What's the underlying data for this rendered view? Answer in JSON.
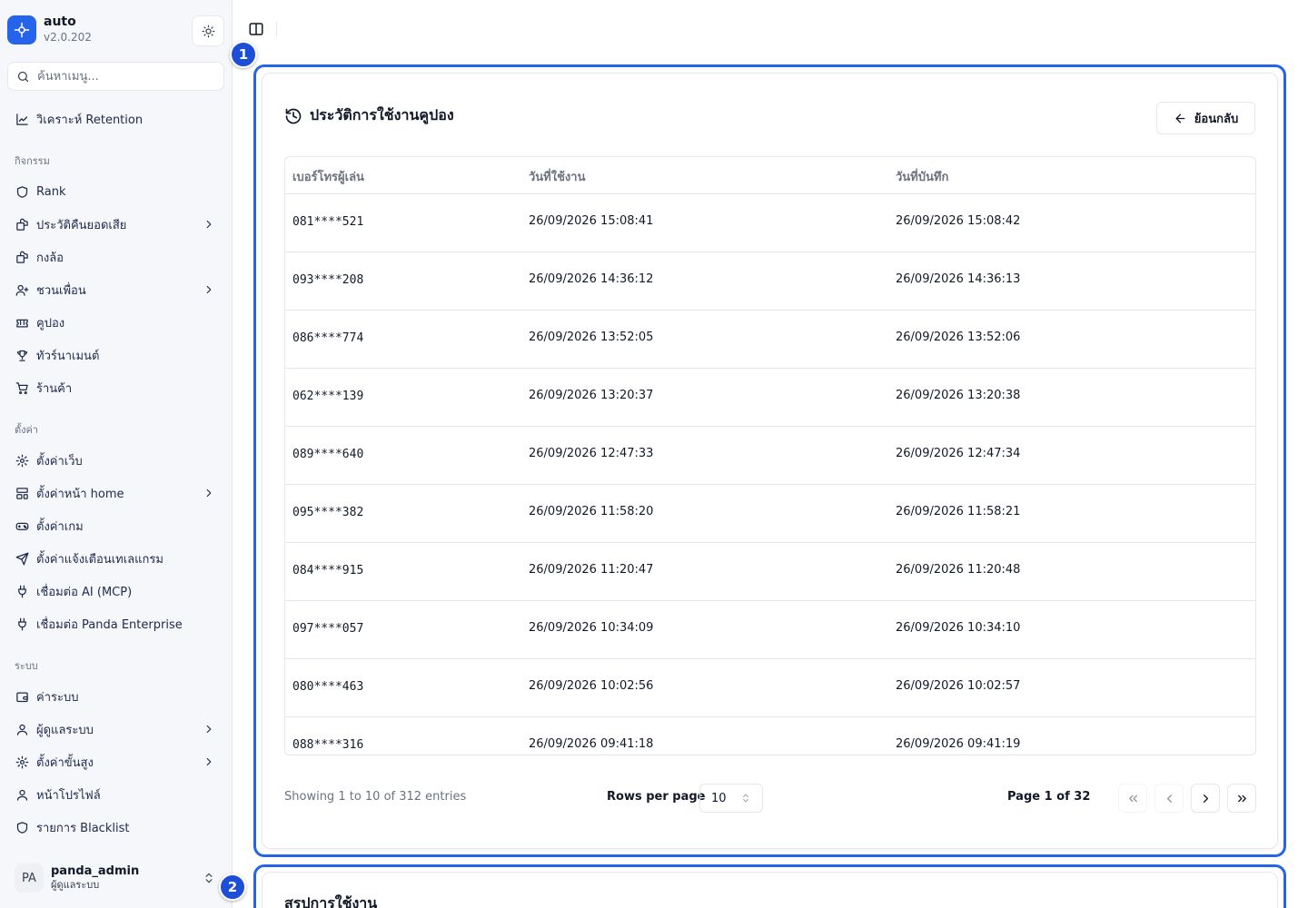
{
  "app": {
    "name": "auto",
    "version": "v2.0.202"
  },
  "search": {
    "placeholder": "ค้นหาเมนู..."
  },
  "sidebar": {
    "top_items": [
      {
        "label": "วิเคราะห์ Retention",
        "icon": "chart-line-icon"
      }
    ],
    "groups": [
      {
        "label": "กิจกรรม",
        "items": [
          {
            "label": "Rank",
            "icon": "shield-icon"
          },
          {
            "label": "ประวัติคืนยอดเสีย",
            "icon": "gift-icon",
            "has_submenu": true
          },
          {
            "label": "กงล้อ",
            "icon": "gift-icon"
          },
          {
            "label": "ชวนเพื่อน",
            "icon": "user-plus-icon",
            "has_submenu": true
          },
          {
            "label": "คูปอง",
            "icon": "ticket-icon"
          },
          {
            "label": "ทัวร์นาเมนต์",
            "icon": "trophy-icon"
          },
          {
            "label": "ร้านค้า",
            "icon": "cart-icon"
          }
        ]
      },
      {
        "label": "ตั้งค่า",
        "items": [
          {
            "label": "ตั้งค่าเว็บ",
            "icon": "gear-icon"
          },
          {
            "label": "ตั้งค่าหน้า home",
            "icon": "layout-icon",
            "has_submenu": true
          },
          {
            "label": "ตั้งค่าเกม",
            "icon": "gamepad-icon"
          },
          {
            "label": "ตั้งค่าแจ้งเตือนเทเลแกรม",
            "icon": "send-icon"
          },
          {
            "label": "เชื่อมต่อ AI (MCP)",
            "icon": "plug-icon"
          },
          {
            "label": "เชื่อมต่อ Panda Enterprise",
            "icon": "plug-icon"
          }
        ]
      },
      {
        "label": "ระบบ",
        "items": [
          {
            "label": "ค่าระบบ",
            "icon": "wallet-icon"
          },
          {
            "label": "ผู้ดูแลระบบ",
            "icon": "user-icon",
            "has_submenu": true
          },
          {
            "label": "ตั้งค่าขั้นสูง",
            "icon": "gear-icon",
            "has_submenu": true
          },
          {
            "label": "หน้าโปรไฟล์",
            "icon": "user-icon"
          },
          {
            "label": "รายการ Blacklist",
            "icon": "shield-icon"
          }
        ]
      }
    ]
  },
  "user": {
    "initials": "PA",
    "name": "panda_admin",
    "role": "ผู้ดูแลระบบ"
  },
  "annotations": [
    "1",
    "2"
  ],
  "card": {
    "title": "ประวัติการใช้งานคูปอง",
    "back_label": "ย้อนกลับ",
    "columns": [
      "เบอร์โทรผู้เล่น",
      "วันที่ใช้งาน",
      "วันที่บันทึก"
    ],
    "rows": [
      [
        "081****521",
        "26/09/2026 15:08:41",
        "26/09/2026 15:08:42"
      ],
      [
        "093****208",
        "26/09/2026 14:36:12",
        "26/09/2026 14:36:13"
      ],
      [
        "086****774",
        "26/09/2026 13:52:05",
        "26/09/2026 13:52:06"
      ],
      [
        "062****139",
        "26/09/2026 13:20:37",
        "26/09/2026 13:20:38"
      ],
      [
        "089****640",
        "26/09/2026 12:47:33",
        "26/09/2026 12:47:34"
      ],
      [
        "095****382",
        "26/09/2026 11:58:20",
        "26/09/2026 11:58:21"
      ],
      [
        "084****915",
        "26/09/2026 11:20:47",
        "26/09/2026 11:20:48"
      ],
      [
        "097****057",
        "26/09/2026 10:34:09",
        "26/09/2026 10:34:10"
      ],
      [
        "080****463",
        "26/09/2026 10:02:56",
        "26/09/2026 10:02:57"
      ],
      [
        "088****316",
        "26/09/2026 09:41:18",
        "26/09/2026 09:41:19"
      ]
    ],
    "footer": {
      "showing": "Showing 1 to 10 of 312 entries",
      "rows_per_page_label": "Rows per page",
      "rows_per_page_value": "10",
      "page_label": "Page 1 of 32"
    }
  },
  "summary_card": {
    "title": "สรุปการใช้งาน"
  },
  "colors": {
    "accent": "#2563eb",
    "badge": "#1d4ed8",
    "sidebar_bg": "#f5f7fb",
    "text_nav": "#1e2a4a"
  }
}
